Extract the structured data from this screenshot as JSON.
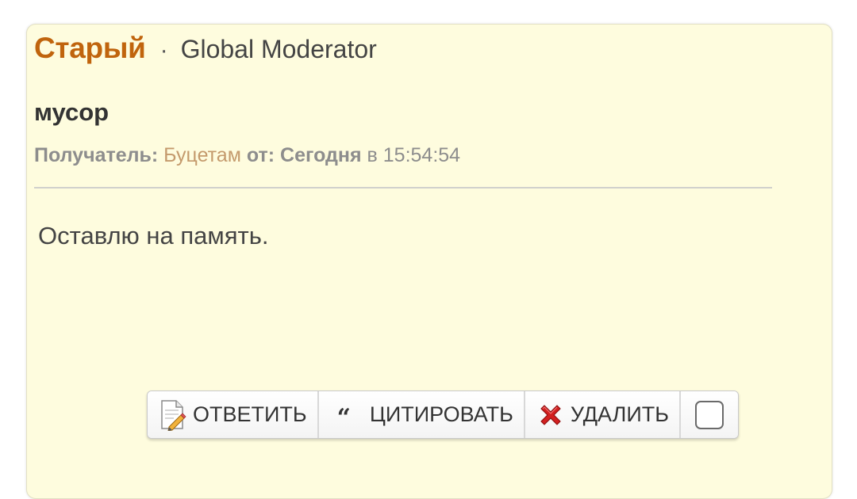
{
  "message": {
    "author": "Старый",
    "separator": "·",
    "role": "Global Moderator",
    "subject": "мусор",
    "meta": {
      "recipient_label": "Получатель:",
      "recipient": "Буцетам",
      "from_label": "от:",
      "date": "Сегодня",
      "time_prefix": "в",
      "time": "15:54:54"
    },
    "body": "Оставлю на память."
  },
  "toolbar": {
    "reply_label": "ОТВЕТИТЬ",
    "quote_label": "ЦИТИРОВАТЬ",
    "delete_label": "УДАЛИТЬ"
  },
  "icons": {
    "reply": "edit-document-icon",
    "quote": "quote-icon",
    "delete": "red-x-icon"
  },
  "colors": {
    "card_background": "#fefcde",
    "author": "#c0640d",
    "recipient": "#c49a6c",
    "delete_icon": "#d32020"
  }
}
